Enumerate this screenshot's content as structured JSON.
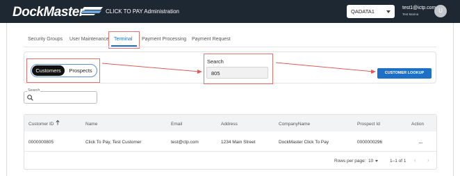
{
  "header": {
    "logo_text": "DockMaster",
    "app_title": "CLICK TO PAY Administration",
    "environment_select": "QADATA1",
    "user_email": "test1@ictp.com",
    "user_name": "Test Marina",
    "avatar_initial": "U"
  },
  "tabs": [
    {
      "label": "Security Groups",
      "active": false
    },
    {
      "label": "User Maintenance",
      "active": false
    },
    {
      "label": "Terminal",
      "active": true
    },
    {
      "label": "Payment Processing",
      "active": false
    },
    {
      "label": "Payment Request",
      "active": false
    }
  ],
  "filter": {
    "toggle_options": [
      "Customers",
      "Prospects"
    ],
    "selected_toggle": "Customers",
    "search_label": "Search",
    "search_value": "805",
    "lookup_button": "CUSTOMER LOOKUP"
  },
  "table_search": {
    "label": "Search",
    "value": ""
  },
  "table": {
    "columns": [
      "Customer ID",
      "Name",
      "Email",
      "Address",
      "CompanyName",
      "Prospect Id",
      "Action"
    ],
    "rows": [
      [
        "0000000805",
        "Click To Pay, Test Customer",
        "test@ctp.com",
        "1234 Main Street",
        "DockMaster Click To Pay",
        "0000000296",
        "..."
      ]
    ],
    "sort_column": "Customer ID",
    "sort_direction": "ascending"
  },
  "pagination": {
    "rows_per_page_label": "Rows per page:",
    "rows_per_page": "10",
    "range": "1–1 of 1"
  },
  "colors": {
    "topbar": "#1e2833",
    "accent": "#1e6fc6",
    "annotation": "#e57373"
  }
}
